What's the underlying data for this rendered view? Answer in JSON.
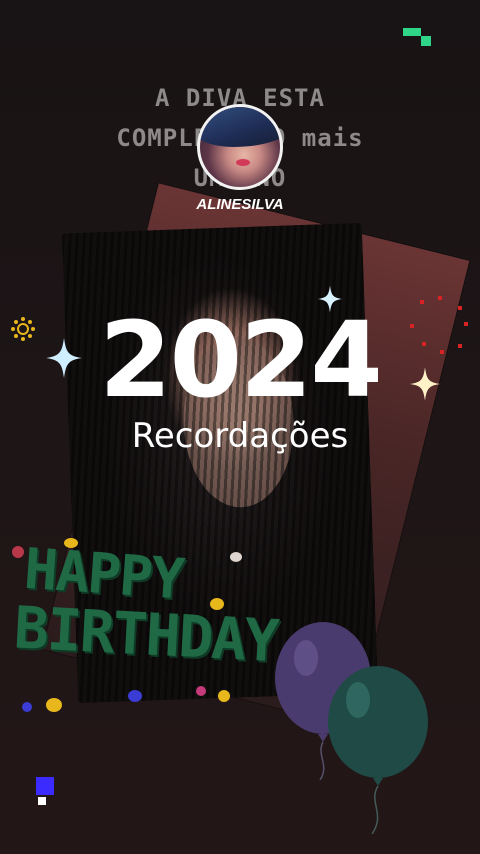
{
  "headline": {
    "line1": "A DIVA ESTA",
    "line2": "COMPLETANDO mais",
    "line3": "UM ANO"
  },
  "profile": {
    "username": "ALINESILVA"
  },
  "title": {
    "year": "2024",
    "subtitle": "Recordações"
  },
  "decoration": {
    "birthday_line1": "HAPPY",
    "birthday_line2": "BIRTHDAY",
    "balloon_colors": [
      "#4a3b6e",
      "#1f4a46"
    ],
    "accent_colors": [
      "#e8b71c",
      "#d72323",
      "#2fd68a",
      "#3b2bff",
      "#7fd0ff"
    ]
  }
}
